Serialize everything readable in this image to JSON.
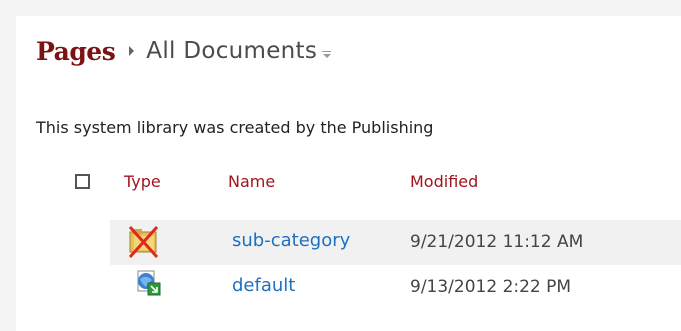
{
  "header": {
    "library": "Pages",
    "view": "All Documents"
  },
  "description": "This system library was created by the Publishing",
  "columns": {
    "type": "Type",
    "name": "Name",
    "modified": "Modified"
  },
  "rows": [
    {
      "icon": "folder-deleted-icon",
      "name": "sub-category",
      "modified": "9/21/2012 11:12 AM"
    },
    {
      "icon": "page-link-icon",
      "name": "default",
      "modified": "9/13/2012 2:22 PM"
    }
  ],
  "colors": {
    "library_title": "#7b1313",
    "column_header": "#a0141e",
    "link": "#1f6fc1",
    "alt_row": "#f1f1f1"
  }
}
